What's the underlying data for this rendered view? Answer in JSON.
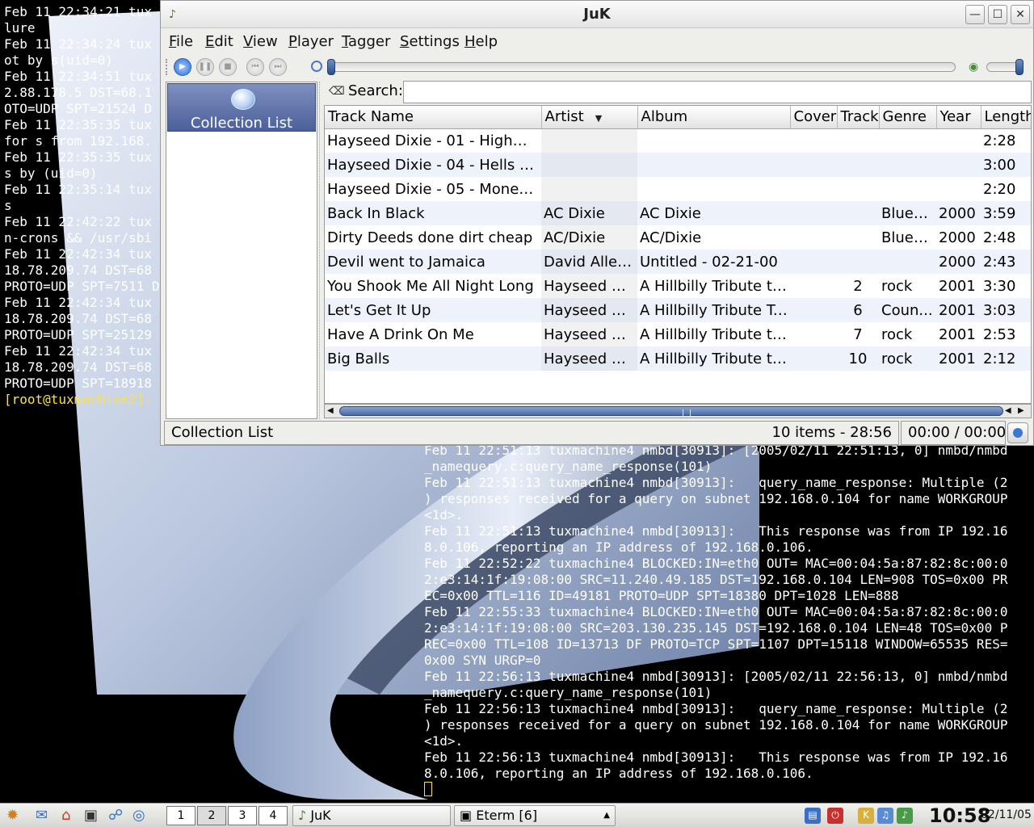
{
  "window": {
    "title": "JuK"
  },
  "menu": {
    "items": [
      {
        "label": "File",
        "u": "F",
        "rest": "ile"
      },
      {
        "label": "Edit",
        "u": "E",
        "rest": "dit"
      },
      {
        "label": "View",
        "u": "V",
        "rest": "iew"
      },
      {
        "label": "Player",
        "u": "P",
        "rest": "layer"
      },
      {
        "label": "Tagger",
        "u": "T",
        "rest": "agger"
      },
      {
        "label": "Settings",
        "u": "S",
        "rest": "ettings"
      },
      {
        "label": "Help",
        "u": "H",
        "rest": "elp"
      }
    ]
  },
  "toolbar": {
    "icons": [
      "play-icon",
      "pause-icon",
      "stop-icon",
      "previous-icon",
      "next-icon",
      "clock-icon",
      "volume-icon"
    ],
    "play_glyph": "▶",
    "pause_glyph": "❚❚",
    "stop_glyph": "■",
    "prev_glyph": "⏮",
    "next_glyph": "⏭",
    "volume_glyph": "◉",
    "playback_position": 0,
    "volume_level": 1.0
  },
  "sidebar": {
    "items": [
      {
        "label": "Collection List",
        "icon": "collection-icon",
        "selected": true
      }
    ]
  },
  "search": {
    "label": "Search:",
    "value": "",
    "placeholder": ""
  },
  "table": {
    "columns": [
      "Track Name",
      "Artist",
      "Album",
      "Cover",
      "Track",
      "Genre",
      "Year",
      "Length"
    ],
    "sort_column": "Artist",
    "sort_glyph": "▼",
    "rows": [
      {
        "track_name": "Hayseed Dixie - 01 - Highway ...",
        "artist": "",
        "album": "",
        "cover": "",
        "track": "",
        "genre": "",
        "year": "",
        "length": "2:28"
      },
      {
        "track_name": "Hayseed Dixie - 04 - Hells Bells",
        "artist": "",
        "album": "",
        "cover": "",
        "track": "",
        "genre": "",
        "year": "",
        "length": "3:00"
      },
      {
        "track_name": "Hayseed Dixie - 05 - Money T...",
        "artist": "",
        "album": "",
        "cover": "",
        "track": "",
        "genre": "",
        "year": "",
        "length": "2:20"
      },
      {
        "track_name": "Back In Black",
        "artist": "AC Dixie",
        "album": "AC Dixie",
        "cover": "",
        "track": "",
        "genre": "Blueg...",
        "year": "2000",
        "length": "3:59"
      },
      {
        "track_name": "Dirty Deeds done dirt cheap",
        "artist": "AC/Dixie",
        "album": "AC/Dixie",
        "cover": "",
        "track": "",
        "genre": "Blueg...",
        "year": "2000",
        "length": "2:48"
      },
      {
        "track_name": "Devil went to Jamaica",
        "artist": "David Allen ...",
        "album": "Untitled - 02-21-00",
        "cover": "",
        "track": "",
        "genre": "",
        "year": "2000",
        "length": "2:43"
      },
      {
        "track_name": "You Shook Me All Night Long",
        "artist": "Hayseed Di...",
        "album": "A Hillbilly Tribute to ...",
        "cover": "",
        "track": "2",
        "genre": "rock",
        "year": "2001",
        "length": "3:30"
      },
      {
        "track_name": "Let's Get It Up",
        "artist": "Hayseed Di...",
        "album": "A Hillbilly Tribute To ...",
        "cover": "",
        "track": "6",
        "genre": "Coun...",
        "year": "2001",
        "length": "3:03"
      },
      {
        "track_name": "Have A Drink On Me",
        "artist": "Hayseed Di...",
        "album": "A Hillbilly Tribute to ...",
        "cover": "",
        "track": "7",
        "genre": "rock",
        "year": "2001",
        "length": "2:53"
      },
      {
        "track_name": "Big Balls",
        "artist": "Hayseed Di...",
        "album": "A Hillbilly Tribute to ...",
        "cover": "",
        "track": "10",
        "genre": "rock",
        "year": "2001",
        "length": "2:12"
      }
    ]
  },
  "status": {
    "playlist": "Collection List",
    "count": "10 items - 28:56",
    "time": "00:00 / 00:00"
  },
  "terminal_left": {
    "lines": [
      "Feb 11 22:34:21 tux",
      "lure",
      "Feb 11 22:34:24 tux",
      "ot by s(uid=0)",
      "Feb 11 22:34:51 tux",
      "2.88.178.5 DST=68.1",
      "OTO=UDP SPT=21524 D",
      "Feb 11 22:35:35 tux",
      "for s from 192.168.",
      "Feb 11 22:35:35 tux",
      "s by (uid=0)",
      "Feb 11 22:35:14 tux",
      "s",
      "Feb 11 22:42:22 tux",
      "n-crons && /usr/sbi",
      "Feb 11 22:42:34 tux",
      "18.78.209.74 DST=68",
      "PROTO=UDP SPT=7511 D",
      "Feb 11 22:42:34 tux",
      "18.78.209.74 DST=68",
      "PROTO=UDP SPT=25129",
      "Feb 11 22:42:34 tux",
      "18.78.209.74 DST=68",
      "PROTO=UDP SPT=18918"
    ],
    "prompt": "[root@tuxmachine2]:"
  },
  "terminal_right": {
    "lines": [
      "Feb 11 22:51:13 tuxmachine4 nmbd[30913]: [2005/02/11 22:51:13, 0] nmbd/nmbd",
      "_namequery.c:query_name_response(101)",
      "Feb 11 22:51:13 tuxmachine4 nmbd[30913]:   query_name_response: Multiple (2",
      ") responses received for a query on subnet 192.168.0.104 for name WORKGROUP",
      "<1d>.",
      "Feb 11 22:51:13 tuxmachine4 nmbd[30913]:   This response was from IP 192.16",
      "8.0.106, reporting an IP address of 192.168.0.106.",
      "Feb 11 22:52:22 tuxmachine4 BLOCKED:IN=eth0 OUT= MAC=00:04:5a:87:82:8c:00:0",
      "2:e3:14:1f:19:08:00 SRC=11.240.49.185 DST=192.168.0.104 LEN=908 TOS=0x00 PR",
      "EC=0x00 TTL=116 ID=49181 PROTO=UDP SPT=18380 DPT=1028 LEN=888",
      "Feb 11 22:55:33 tuxmachine4 BLOCKED:IN=eth0 OUT= MAC=00:04:5a:87:82:8c:00:0",
      "2:e3:14:1f:19:08:00 SRC=203.130.235.145 DST=192.168.0.104 LEN=48 TOS=0x00 P",
      "REC=0x00 TTL=108 ID=13713 DF PROTO=TCP SPT=1107 DPT=15118 WINDOW=65535 RES=",
      "0x00 SYN URGP=0",
      "Feb 11 22:56:13 tuxmachine4 nmbd[30913]: [2005/02/11 22:56:13, 0] nmbd/nmbd",
      "_namequery.c:query_name_response(101)",
      "Feb 11 22:56:13 tuxmachine4 nmbd[30913]:   query_name_response: Multiple (2",
      ") responses received for a query on subnet 192.168.0.104 for name WORKGROUP",
      "<1d>.",
      "Feb 11 22:56:13 tuxmachine4 nmbd[30913]:   This response was from IP 192.16",
      "8.0.106, reporting an IP address of 192.168.0.106."
    ]
  },
  "taskbar": {
    "launchers": [
      "kde-menu-icon",
      "mail-icon",
      "home-icon",
      "terminal-icon",
      "network-icon",
      "browser-icon"
    ],
    "pager": [
      "1",
      "2",
      "3",
      "4"
    ],
    "active_desktop": "2",
    "tasks": [
      {
        "label": "JuK",
        "icon": "juk-icon"
      },
      {
        "label": "Eterm [6]",
        "icon": "terminal-icon"
      }
    ],
    "tray": [
      "network-tray-icon",
      "power-tray-icon",
      "klipper-icon",
      "kmix-icon",
      "music-tray-icon"
    ],
    "clock_time": "10:58",
    "clock_date": "02/11/05"
  },
  "colors": {
    "accent": "#4b5f9a",
    "row_alt": "#eef2fb",
    "prompt": "#ffe040"
  }
}
